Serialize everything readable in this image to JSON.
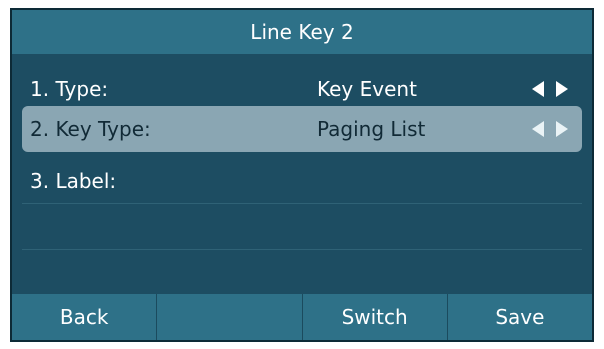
{
  "screen": {
    "title": "Line Key 2"
  },
  "rows": [
    {
      "label": "1. Type:",
      "value": "Key Event"
    },
    {
      "label": "2. Key Type:",
      "value": "Paging List"
    },
    {
      "label": "3. Label:",
      "value": ""
    }
  ],
  "softkeys": [
    "Back",
    "",
    "Switch",
    "Save"
  ],
  "colors": {
    "background": "#1d4d62",
    "title_bar": "#2e7188",
    "selected_row": "#8aa6b3",
    "text": "#ffffff"
  },
  "icons": [
    "arrow-left-icon",
    "arrow-right-icon"
  ]
}
